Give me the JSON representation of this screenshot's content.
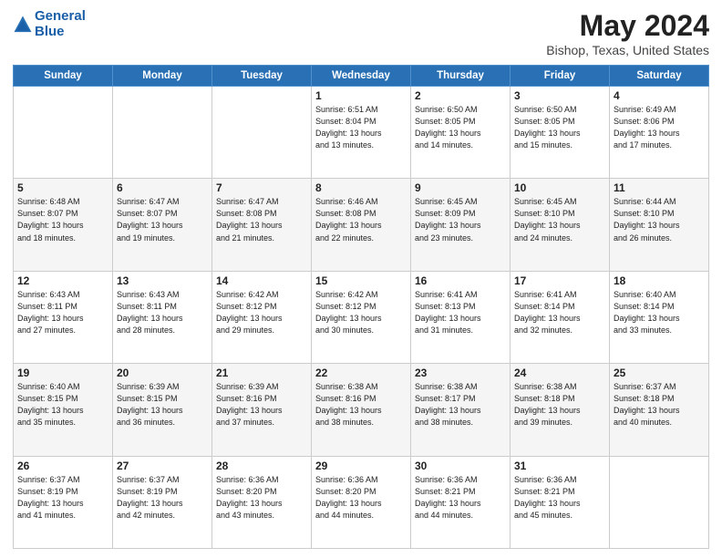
{
  "header": {
    "logo_line1": "General",
    "logo_line2": "Blue",
    "title": "May 2024",
    "location": "Bishop, Texas, United States"
  },
  "weekdays": [
    "Sunday",
    "Monday",
    "Tuesday",
    "Wednesday",
    "Thursday",
    "Friday",
    "Saturday"
  ],
  "weeks": [
    [
      {
        "day": "",
        "info": ""
      },
      {
        "day": "",
        "info": ""
      },
      {
        "day": "",
        "info": ""
      },
      {
        "day": "1",
        "info": "Sunrise: 6:51 AM\nSunset: 8:04 PM\nDaylight: 13 hours\nand 13 minutes."
      },
      {
        "day": "2",
        "info": "Sunrise: 6:50 AM\nSunset: 8:05 PM\nDaylight: 13 hours\nand 14 minutes."
      },
      {
        "day": "3",
        "info": "Sunrise: 6:50 AM\nSunset: 8:05 PM\nDaylight: 13 hours\nand 15 minutes."
      },
      {
        "day": "4",
        "info": "Sunrise: 6:49 AM\nSunset: 8:06 PM\nDaylight: 13 hours\nand 17 minutes."
      }
    ],
    [
      {
        "day": "5",
        "info": "Sunrise: 6:48 AM\nSunset: 8:07 PM\nDaylight: 13 hours\nand 18 minutes."
      },
      {
        "day": "6",
        "info": "Sunrise: 6:47 AM\nSunset: 8:07 PM\nDaylight: 13 hours\nand 19 minutes."
      },
      {
        "day": "7",
        "info": "Sunrise: 6:47 AM\nSunset: 8:08 PM\nDaylight: 13 hours\nand 21 minutes."
      },
      {
        "day": "8",
        "info": "Sunrise: 6:46 AM\nSunset: 8:08 PM\nDaylight: 13 hours\nand 22 minutes."
      },
      {
        "day": "9",
        "info": "Sunrise: 6:45 AM\nSunset: 8:09 PM\nDaylight: 13 hours\nand 23 minutes."
      },
      {
        "day": "10",
        "info": "Sunrise: 6:45 AM\nSunset: 8:10 PM\nDaylight: 13 hours\nand 24 minutes."
      },
      {
        "day": "11",
        "info": "Sunrise: 6:44 AM\nSunset: 8:10 PM\nDaylight: 13 hours\nand 26 minutes."
      }
    ],
    [
      {
        "day": "12",
        "info": "Sunrise: 6:43 AM\nSunset: 8:11 PM\nDaylight: 13 hours\nand 27 minutes."
      },
      {
        "day": "13",
        "info": "Sunrise: 6:43 AM\nSunset: 8:11 PM\nDaylight: 13 hours\nand 28 minutes."
      },
      {
        "day": "14",
        "info": "Sunrise: 6:42 AM\nSunset: 8:12 PM\nDaylight: 13 hours\nand 29 minutes."
      },
      {
        "day": "15",
        "info": "Sunrise: 6:42 AM\nSunset: 8:12 PM\nDaylight: 13 hours\nand 30 minutes."
      },
      {
        "day": "16",
        "info": "Sunrise: 6:41 AM\nSunset: 8:13 PM\nDaylight: 13 hours\nand 31 minutes."
      },
      {
        "day": "17",
        "info": "Sunrise: 6:41 AM\nSunset: 8:14 PM\nDaylight: 13 hours\nand 32 minutes."
      },
      {
        "day": "18",
        "info": "Sunrise: 6:40 AM\nSunset: 8:14 PM\nDaylight: 13 hours\nand 33 minutes."
      }
    ],
    [
      {
        "day": "19",
        "info": "Sunrise: 6:40 AM\nSunset: 8:15 PM\nDaylight: 13 hours\nand 35 minutes."
      },
      {
        "day": "20",
        "info": "Sunrise: 6:39 AM\nSunset: 8:15 PM\nDaylight: 13 hours\nand 36 minutes."
      },
      {
        "day": "21",
        "info": "Sunrise: 6:39 AM\nSunset: 8:16 PM\nDaylight: 13 hours\nand 37 minutes."
      },
      {
        "day": "22",
        "info": "Sunrise: 6:38 AM\nSunset: 8:16 PM\nDaylight: 13 hours\nand 38 minutes."
      },
      {
        "day": "23",
        "info": "Sunrise: 6:38 AM\nSunset: 8:17 PM\nDaylight: 13 hours\nand 38 minutes."
      },
      {
        "day": "24",
        "info": "Sunrise: 6:38 AM\nSunset: 8:18 PM\nDaylight: 13 hours\nand 39 minutes."
      },
      {
        "day": "25",
        "info": "Sunrise: 6:37 AM\nSunset: 8:18 PM\nDaylight: 13 hours\nand 40 minutes."
      }
    ],
    [
      {
        "day": "26",
        "info": "Sunrise: 6:37 AM\nSunset: 8:19 PM\nDaylight: 13 hours\nand 41 minutes."
      },
      {
        "day": "27",
        "info": "Sunrise: 6:37 AM\nSunset: 8:19 PM\nDaylight: 13 hours\nand 42 minutes."
      },
      {
        "day": "28",
        "info": "Sunrise: 6:36 AM\nSunset: 8:20 PM\nDaylight: 13 hours\nand 43 minutes."
      },
      {
        "day": "29",
        "info": "Sunrise: 6:36 AM\nSunset: 8:20 PM\nDaylight: 13 hours\nand 44 minutes."
      },
      {
        "day": "30",
        "info": "Sunrise: 6:36 AM\nSunset: 8:21 PM\nDaylight: 13 hours\nand 44 minutes."
      },
      {
        "day": "31",
        "info": "Sunrise: 6:36 AM\nSunset: 8:21 PM\nDaylight: 13 hours\nand 45 minutes."
      },
      {
        "day": "",
        "info": ""
      }
    ]
  ]
}
